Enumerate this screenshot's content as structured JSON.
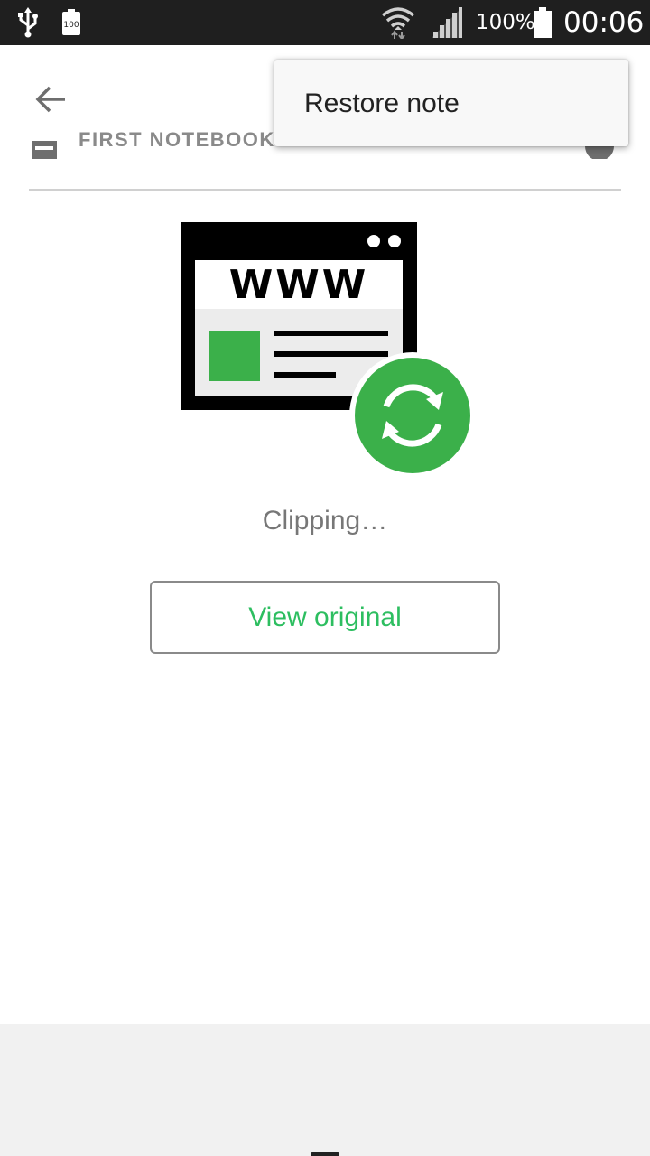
{
  "status_bar": {
    "battery_percent": "100%",
    "time": "00:06",
    "battery_saver_badge": "100",
    "icons": [
      "usb-icon",
      "battery-saver-icon",
      "wifi-icon",
      "signal-icon",
      "battery-icon"
    ]
  },
  "header": {
    "notebook_name": "FIRST NOTEBOOK",
    "icons": [
      "back-arrow-icon",
      "notebook-icon",
      "info-icon"
    ]
  },
  "menu": {
    "restore_label": "Restore note"
  },
  "illustration": {
    "browser_text": "WWW",
    "icons": [
      "web-browser-icon",
      "sync-icon"
    ]
  },
  "content": {
    "status_text": "Clipping…",
    "view_original_label": "View original"
  },
  "colors": {
    "accent_green": "#2dbe60",
    "illustration_green": "#3bb04a",
    "status_bar_bg": "#1f1f1f",
    "bottom_panel_bg": "#f1f1f1"
  }
}
